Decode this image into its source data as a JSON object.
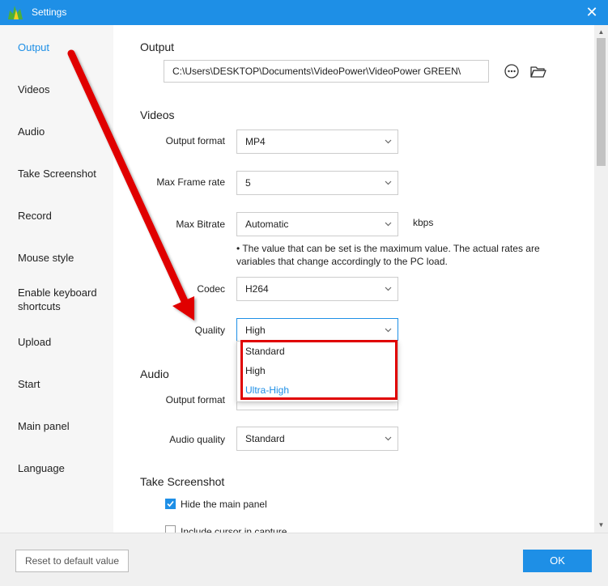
{
  "window": {
    "title": "Settings",
    "close_label": "✕"
  },
  "sidebar": {
    "items": [
      {
        "label": "Output",
        "active": true
      },
      {
        "label": "Videos"
      },
      {
        "label": "Audio"
      },
      {
        "label": "Take Screenshot"
      },
      {
        "label": "Record"
      },
      {
        "label": "Mouse style"
      },
      {
        "label": "Enable keyboard shortcuts"
      },
      {
        "label": "Upload"
      },
      {
        "label": "Start"
      },
      {
        "label": "Main panel"
      },
      {
        "label": "Language"
      }
    ]
  },
  "output": {
    "title": "Output",
    "path_value": "C:\\Users\\DESKTOP\\Documents\\VideoPower\\VideoPower GREEN\\"
  },
  "videos": {
    "title": "Videos",
    "output_format": {
      "label": "Output format",
      "value": "MP4"
    },
    "max_frame_rate": {
      "label": "Max Frame rate",
      "value": "5"
    },
    "max_bitrate": {
      "label": "Max Bitrate",
      "value": "Automatic",
      "unit": "kbps"
    },
    "note": "• The value that can be set is the maximum value. The actual rates are variables that change accordingly to the PC load.",
    "codec": {
      "label": "Codec",
      "value": "H264"
    },
    "quality": {
      "label": "Quality",
      "value": "High",
      "options": [
        "Standard",
        "High",
        "Ultra-High"
      ],
      "highlighted_option": "Ultra-High"
    }
  },
  "audio": {
    "title": "Audio",
    "output_format": {
      "label": "Output format"
    },
    "audio_quality": {
      "label": "Audio quality",
      "value": "Standard"
    }
  },
  "take_screenshot": {
    "title": "Take Screenshot",
    "hide_main_panel": {
      "label": "Hide the main panel",
      "checked": true
    },
    "include_cursor": {
      "label": "Include cursor in capture",
      "checked": false
    }
  },
  "footer": {
    "reset_label": "Reset to default value",
    "ok_label": "OK"
  },
  "colors": {
    "accent": "#1e8fe6",
    "annotation_red": "#e00000",
    "sidebar_bg": "#f6f6f6"
  }
}
